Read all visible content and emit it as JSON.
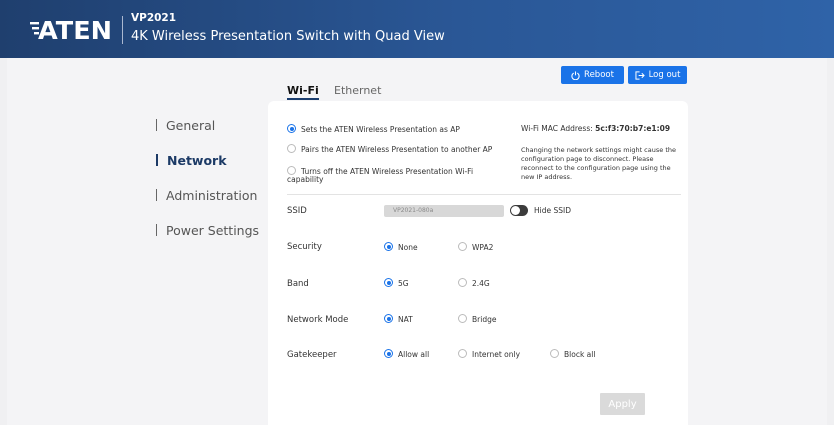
{
  "header": {
    "brand": "ATEN",
    "model": "VP2021",
    "subtitle": "4K Wireless Presentation Switch with Quad View"
  },
  "top_buttons": {
    "reboot": "Reboot",
    "logout": "Log out"
  },
  "tabs": [
    {
      "label": "Wi-Fi",
      "active": true
    },
    {
      "label": "Ethernet",
      "active": false
    }
  ],
  "sidebar": {
    "items": [
      {
        "label": "General",
        "active": false
      },
      {
        "label": "Network",
        "active": true
      },
      {
        "label": "Administration",
        "active": false
      },
      {
        "label": "Power Settings",
        "active": false
      }
    ]
  },
  "wifi_mode": {
    "options": [
      "Sets the ATEN Wireless Presentation as AP",
      "Pairs the ATEN Wireless Presentation to another AP",
      "Turns off the ATEN Wireless Presentation Wi-Fi",
      "capability"
    ],
    "selected_index": 0
  },
  "mac": {
    "label": "Wi-Fi MAC Address:",
    "value": "5c:f3:70:b7:e1:09"
  },
  "warning": "Changing the network settings might cause the configuration page to disconnect. Please reconnect to the configuration page using the new IP address.",
  "fields": {
    "ssid": {
      "label": "SSID",
      "value": "VP2021-080a",
      "hide_label": "Hide SSID",
      "hide_enabled": false
    },
    "security": {
      "label": "Security",
      "options": [
        "None",
        "WPA2"
      ],
      "selected": "None"
    },
    "band": {
      "label": "Band",
      "options": [
        "5G",
        "2.4G"
      ],
      "selected": "5G"
    },
    "network_mode": {
      "label": "Network Mode",
      "options": [
        "NAT",
        "Bridge"
      ],
      "selected": "NAT"
    },
    "gatekeeper": {
      "label": "Gatekeeper",
      "options": [
        "Allow all",
        "Internet only",
        "Block all"
      ],
      "selected": "Allow all"
    }
  },
  "apply_label": "Apply",
  "colors": {
    "header": "#2a5796",
    "accent": "#1a73e8",
    "nav_active": "#1c3a66",
    "disabled": "#dadada"
  }
}
